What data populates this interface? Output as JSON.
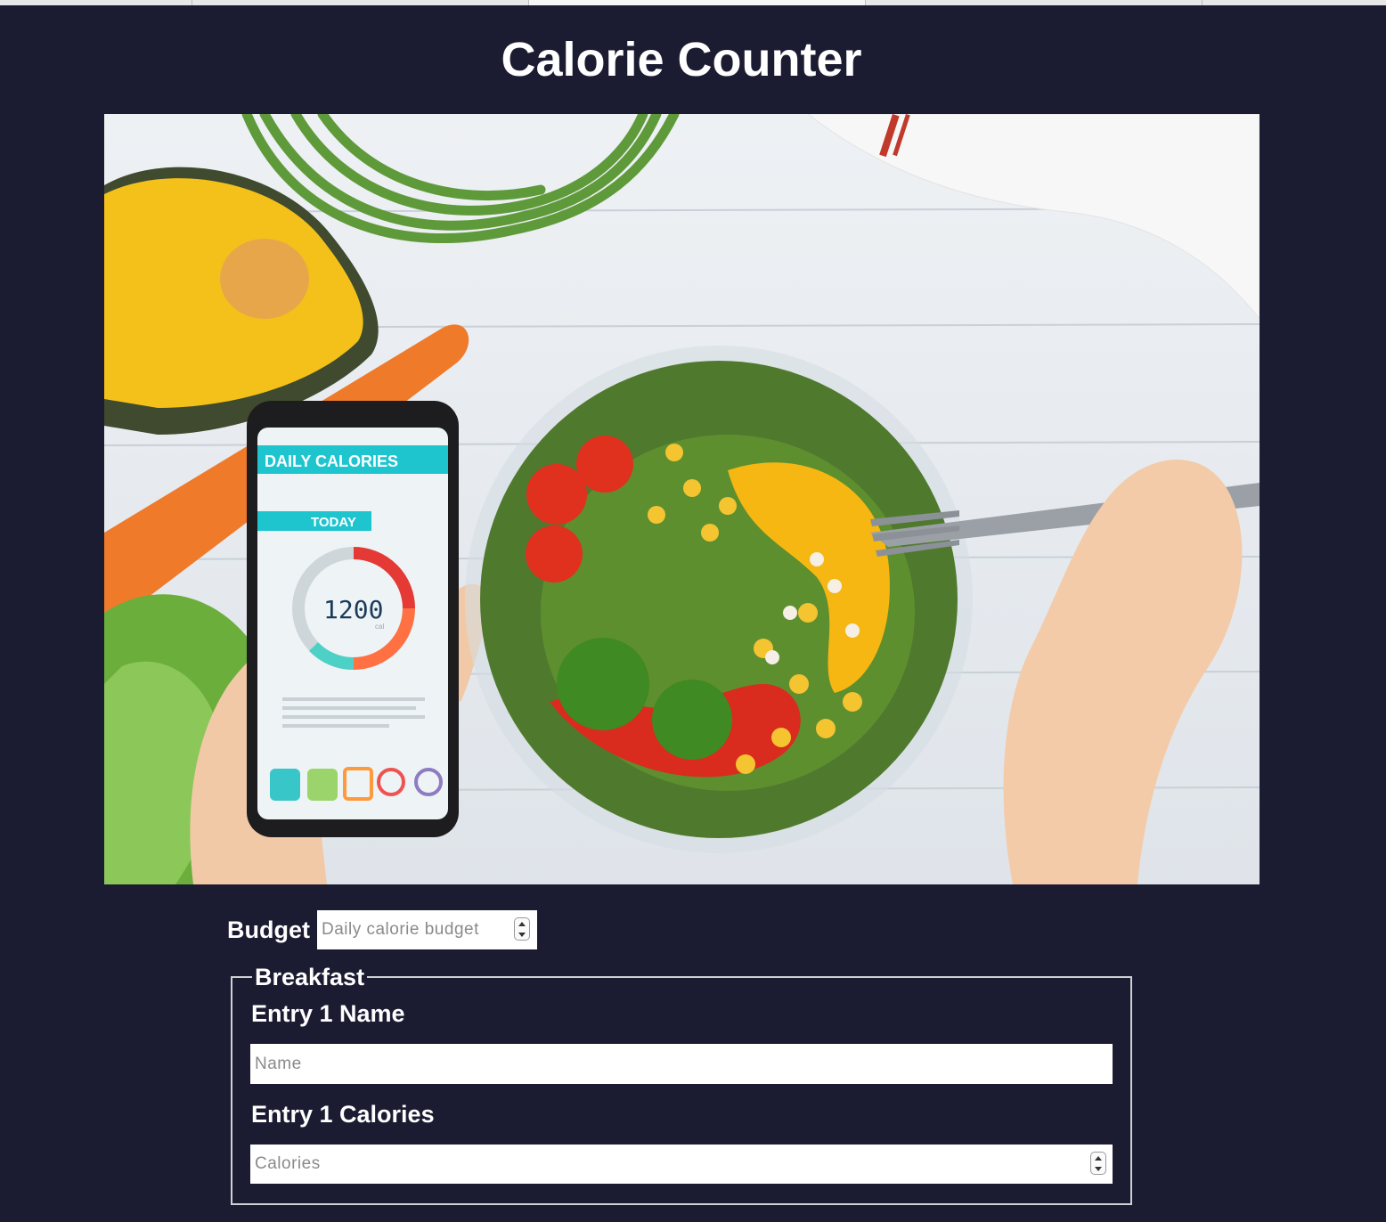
{
  "page": {
    "title": "Calorie Counter"
  },
  "hero_image": {
    "alt": "Daily calories app on phone beside a salad bowl",
    "phone_header": "DAILY CALORIES",
    "phone_tab": "TODAY",
    "phone_value": "1200",
    "phone_unit": "cal"
  },
  "budget": {
    "label": "Budget",
    "placeholder": "Daily calorie budget",
    "value": ""
  },
  "breakfast": {
    "legend": "Breakfast",
    "entry_name_label": "Entry 1 Name",
    "entry_name_placeholder": "Name",
    "entry_calories_label": "Entry 1 Calories",
    "entry_calories_placeholder": "Calories"
  },
  "colors": {
    "page_background": "#1b1b32",
    "text": "#ffffff",
    "input_background": "#ffffff",
    "fieldset_border": "#d0d0d5"
  }
}
